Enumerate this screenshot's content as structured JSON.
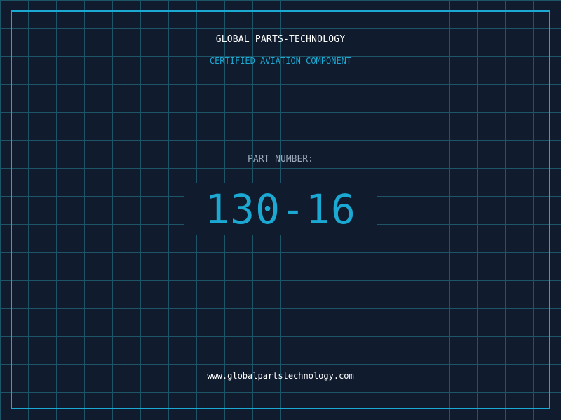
{
  "header": {
    "company": "GLOBAL PARTS-TECHNOLOGY",
    "subtitle": "CERTIFIED AVIATION COMPONENT"
  },
  "part": {
    "label": "PART NUMBER:",
    "number": "130-16"
  },
  "footer": {
    "website": "www.globalpartstechnology.com"
  },
  "colors": {
    "background": "#101b2d",
    "grid": "#1d5468",
    "accent": "#1ba8d2",
    "text": "#ffffff",
    "muted": "#9aa8b8"
  }
}
